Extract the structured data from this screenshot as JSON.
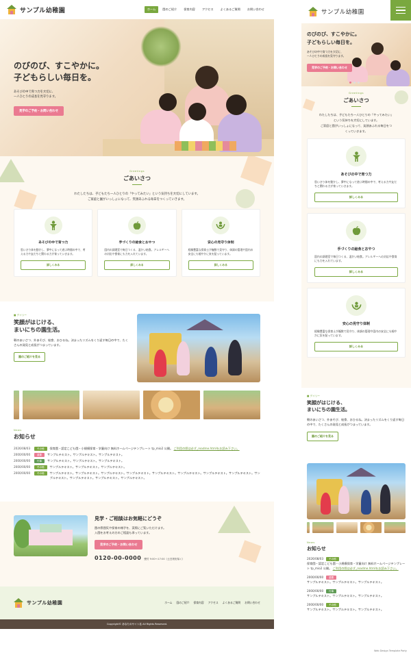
{
  "brand": {
    "name": "サンプル幼稚園"
  },
  "colors": {
    "green": "#7aa83f",
    "pink": "#ea7a91",
    "cream": "#fdf8f0",
    "brown": "#5a4a3f",
    "lightgreen": "#eef4e2"
  },
  "nav": [
    {
      "label": "ホーム",
      "active": true
    },
    {
      "label": "園のご紹介",
      "active": false
    },
    {
      "label": "保育内容",
      "active": false
    },
    {
      "label": "アクセス",
      "active": false
    },
    {
      "label": "よくあるご質問",
      "active": false
    },
    {
      "label": "お問い合わせ",
      "active": false
    }
  ],
  "hero": {
    "title": "のびのび、すこやかに。\n子どもらしい毎日を。",
    "lead": "あそびの中で育つ力を大切に、\n一人ひとりの成長を見守ります。",
    "cta": "見学のご予約・お問い合わせ",
    "slide_count": 3,
    "slide_active": 1
  },
  "greeting": {
    "en": "Greetings",
    "ja": "ごあいさつ",
    "text": "わたしたちは、子どもたち一人ひとりの「やってみたい」という気持ちを大切にしています。\nご家庭と園がいっしょになって、笑顔あふれる毎日をつくっていきます。",
    "text_mobile": "わたしたちは、子どもたち一人ひとりの「やってみたい」\nという気持ちを大切にしています。\nご家庭と園がいっしょになって、笑顔あふれる毎日をつ\nくっていきます。",
    "cards": [
      {
        "icon": "child-icon",
        "glyph": "🯅",
        "title": "あそびの中で育つ力",
        "text": "思いきり体を動かし、夢中になって遊ぶ時間の中で、考える力や友だちと関わる力が育っていきます。",
        "button": "詳しくみる"
      },
      {
        "icon": "apple-icon",
        "glyph": "●",
        "title": "手づくりの給食とおやつ",
        "text": "園内の調理室で毎日つくる、温かい給食。アレルギーへの対応や食育にも力を入れています。",
        "button": "詳しくみる"
      },
      {
        "icon": "care-hands-icon",
        "glyph": "♥",
        "title": "安心の見守り体制",
        "text": "経験豊富な保育士が複数で見守り、体調の管理や園内の安全にも細やかに気を配っています。",
        "button": "詳しくみる"
      }
    ]
  },
  "daily": {
    "en": "デイリー",
    "title": "笑顔がはじける、\nまいにちの園生活。",
    "text": "朝のあいさつ、外あそび、給食、おひるね。決まったリズムをくり返す毎日の中で、たくさんの発見と成長がつまっています。",
    "button": "園のご紹介を見る"
  },
  "news": {
    "en": "News",
    "title": "お知らせ",
    "items": [
      {
        "date": "2026/08/03",
        "badge": "その他",
        "type": "other",
        "text": "保育園・認定こども園・小規模保育・学童向け 無料ホームページテンプレート tp_mio2 公開。",
        "link": "ご利用の際は必ず_readme.htmlをお読み下さい。"
      },
      {
        "date": "2000/00/00",
        "badge": "重要",
        "type": "imp",
        "text": "サンプルテキスト。サンプルテキスト。サンプルテキスト。",
        "link": ""
      },
      {
        "date": "2000/00/00",
        "badge": "行事",
        "type": "event",
        "text": "サンプルテキスト。サンプルテキスト。サンプルテキスト。",
        "link": ""
      },
      {
        "date": "2000/00/00",
        "badge": "その他",
        "type": "other",
        "text": "サンプルテキスト。サンプルテキスト。サンプルテキスト。",
        "link": ""
      },
      {
        "date": "2000/00/00",
        "badge": "その他",
        "type": "other",
        "text": "サンプルテキスト。サンプルテキスト。サンプルテキスト。サンプルテキスト。サンプルテキスト。サンプルテキスト。サンプルテキスト。サンプルテキスト。サンプルテキスト。サンプルテキスト。サンプルテキスト。サンプルテキスト。",
        "link": ""
      }
    ]
  },
  "contact": {
    "title": "見学・ご相談はお気軽にどうぞ",
    "text": "園の雰囲気や保育の様子を、実際にご覧いただけます。\n入園をお考えの方のご相談も承っています。",
    "cta": "見学のご予約・お問い合わせ",
    "tel": "0120-00-0000",
    "hours": "受付 9:00〜17:00（土日祝を除く）"
  },
  "footer": {
    "copyright": "Copyright© あなたのサイト名 All Rights Reserved.",
    "credit": "Web Design Template Party"
  }
}
